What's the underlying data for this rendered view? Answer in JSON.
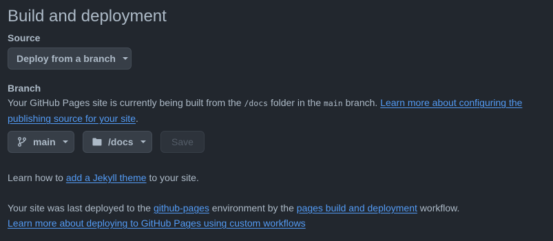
{
  "page": {
    "title": "Build and deployment"
  },
  "source": {
    "label": "Source",
    "dropdown_value": "Deploy from a branch"
  },
  "branch": {
    "label": "Branch",
    "description_prefix": "Your GitHub Pages site is currently being built from the ",
    "folder_code": "/docs",
    "description_middle": " folder in the ",
    "branch_code": "main",
    "description_suffix": " branch. ",
    "learn_more_link": "Learn more about configuring the publishing source for your site",
    "period": ".",
    "branch_button": "main",
    "folder_button": "/docs",
    "save_button": "Save"
  },
  "jekyll": {
    "prefix": "Learn how to ",
    "link": "add a Jekyll theme",
    "suffix": " to your site."
  },
  "deployment": {
    "prefix": "Your site was last deployed to the ",
    "env_link": "github-pages",
    "middle": " environment by the ",
    "workflow_link": "pages build and deployment",
    "suffix": " workflow.",
    "custom_workflows_link": "Learn more about deploying to GitHub Pages using custom workflows"
  },
  "icons": {
    "branch_button": "git-branch-icon",
    "folder_button": "folder-icon",
    "dropdown": "caret-down-icon"
  },
  "colors": {
    "background": "#22272e",
    "text": "#adbac7",
    "link": "#539bf5",
    "button_bg": "#373e47",
    "button_border": "#444c56",
    "disabled_text": "#545d68"
  }
}
